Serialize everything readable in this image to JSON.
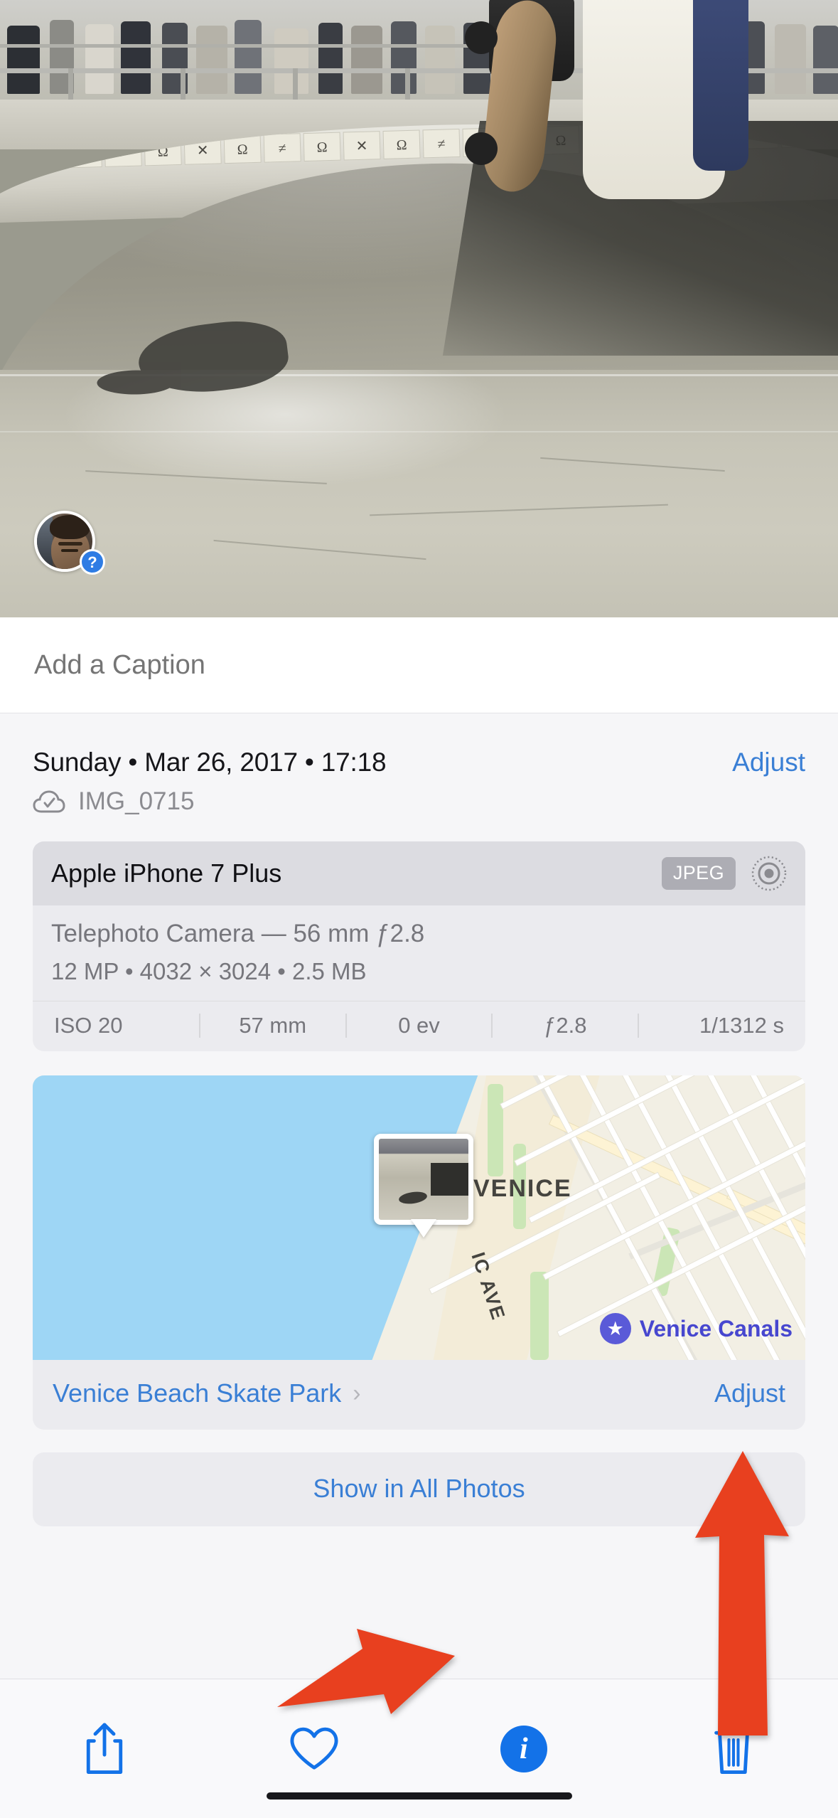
{
  "photo": {
    "alt_description": "Skateboarder at Venice Beach skate park bowl",
    "face_badge": "?",
    "face_chip_name": "unidentified-person"
  },
  "caption": {
    "placeholder": "Add a Caption",
    "value": ""
  },
  "metadata": {
    "date_line": "Sunday • Mar 26, 2017 • 17:18",
    "adjust_label": "Adjust",
    "file_name": "IMG_0715",
    "cloud_icon": "cloud-check-icon"
  },
  "camera": {
    "device": "Apple iPhone 7 Plus",
    "format_badge": "JPEG",
    "lens_icon": "aperture-icon",
    "lens_line": "Telephoto Camera — 56 mm ƒ2.8",
    "specs_line": "12 MP  •   4032 × 3024  •   2.5 MB",
    "exif": [
      "ISO 20",
      "57 mm",
      "0 ev",
      "ƒ2.8",
      "1/1312 s"
    ]
  },
  "map": {
    "area_label": "VENICE",
    "street_label": "IC AVE",
    "poi_label": "Venice Canals",
    "poi_icon": "star-pin-icon",
    "pin_icon": "photo-pin-icon",
    "location_name": "Venice Beach Skate Park",
    "chevron": "›",
    "adjust_label": "Adjust"
  },
  "actions": {
    "show_in_all_photos": "Show in All Photos"
  },
  "toolbar": {
    "share_icon": "share-icon",
    "favorite_icon": "heart-icon",
    "info_icon": "info-icon",
    "info_glyph": "i",
    "delete_icon": "trash-icon"
  },
  "colors": {
    "accent_blue": "#3a7fd5",
    "info_blue": "#1372e8",
    "annotation_red": "#E8401F",
    "panel_gray": "#ebebef",
    "card_header_gray": "#dcdce1"
  }
}
